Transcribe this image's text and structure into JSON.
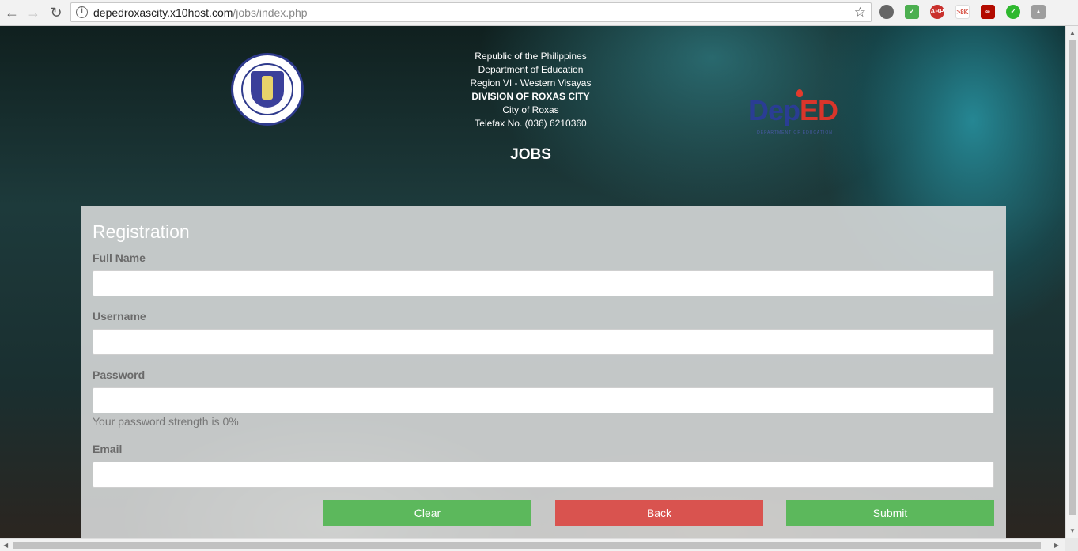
{
  "browser": {
    "url_host": "depedroxascity.x10host.com",
    "url_path": "/jobs/index.php",
    "extensions": [
      {
        "name": "lightbulb-icon",
        "label": "",
        "color": "#666666"
      },
      {
        "name": "shield-check-icon",
        "label": "",
        "color": "#4caf50"
      },
      {
        "name": "adblock-plus-icon",
        "label": "ABP",
        "color": "#c9302c"
      },
      {
        "name": "gmail-icon",
        "label": ">8K",
        "color": "#d44638"
      },
      {
        "name": "pdf-icon",
        "label": "",
        "color": "#b30b00"
      },
      {
        "name": "check-circle-icon",
        "label": "",
        "color": "#2eb82e"
      },
      {
        "name": "drive-icon",
        "label": "",
        "color": "#9e9e9e"
      }
    ]
  },
  "header": {
    "lines": [
      "Republic of the Philippines",
      "Department of Education",
      "Region VI - Western Visayas",
      "DIVISION OF ROXAS CITY",
      "City of Roxas",
      "Telefax No. (036) 6210360"
    ],
    "title": "JOBS",
    "logo_left": "seal-logo",
    "logo_right": "deped-logo"
  },
  "form": {
    "heading": "Registration",
    "fields": [
      {
        "label": "Full Name",
        "value": "",
        "placeholder": ""
      },
      {
        "label": "Username",
        "value": "",
        "placeholder": ""
      },
      {
        "label": "Password",
        "value": "",
        "placeholder": ""
      },
      {
        "label": "Email",
        "value": "",
        "placeholder": ""
      }
    ],
    "password_strength": "Your password strength is 0%",
    "buttons": {
      "clear": "Clear",
      "back": "Back",
      "submit": "Submit"
    }
  },
  "colors": {
    "success": "#5cb85c",
    "danger": "#d9534f",
    "deped_blue": "#2a3d94",
    "deped_red": "#d9352b"
  }
}
